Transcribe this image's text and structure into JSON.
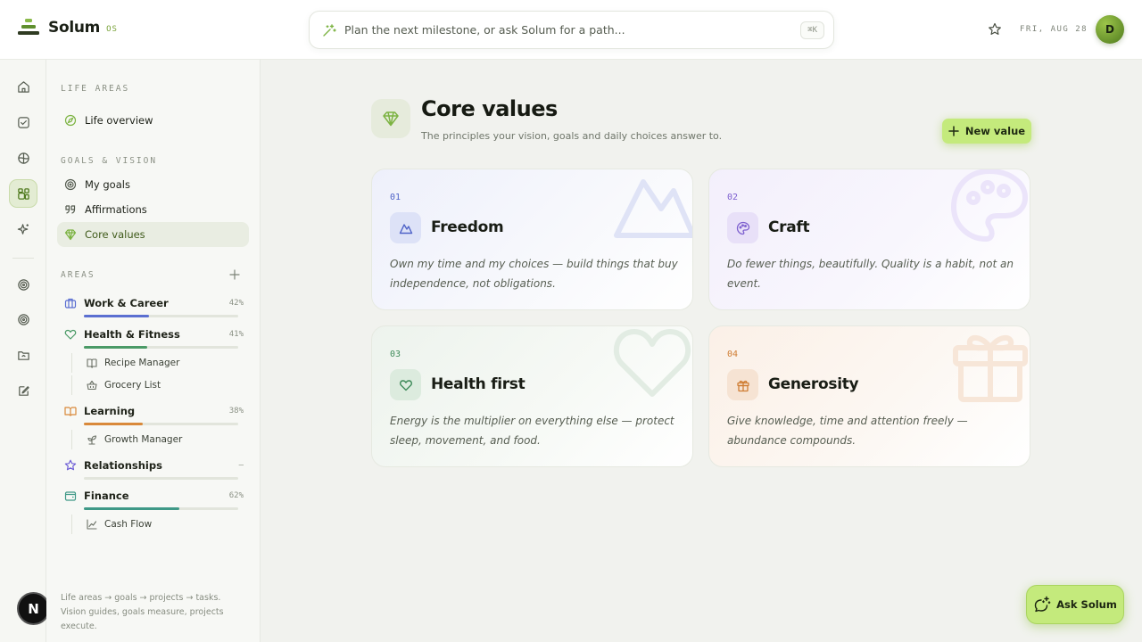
{
  "brand": {
    "name": "Solum",
    "tag": "OS"
  },
  "search": {
    "placeholder": "Plan the next milestone, or ask Solum for a path...",
    "shortcut": "⌘K"
  },
  "top": {
    "date": "FRI, AUG 28",
    "avatar_initial": "D"
  },
  "rail": {
    "items": [
      "home-icon",
      "check-square-icon",
      "compass-icon",
      "grid-icon",
      "sparkle-icon",
      "target-icon",
      "target-icon",
      "folder-icon",
      "edit-icon"
    ],
    "bottom_initial": "N"
  },
  "sidebar": {
    "life_areas_label": "LIFE AREAS",
    "life_overview": "Life overview",
    "goals_vision_label": "GOALS & VISION",
    "my_goals": "My goals",
    "affirmations": "Affirmations",
    "core_values": "Core values",
    "areas_label": "AREAS",
    "areas": [
      {
        "name": "Work & Career",
        "pct": "42%",
        "progress": 0.42,
        "color": "#5b6fd1"
      },
      {
        "name": "Health & Fitness",
        "pct": "41%",
        "progress": 0.41,
        "color": "#4a9a66"
      },
      {
        "name": "Learning",
        "pct": "38%",
        "progress": 0.38,
        "color": "#d9893a"
      },
      {
        "name": "Relationships",
        "pct": "–",
        "progress": 0,
        "color": "#8a7bd8"
      },
      {
        "name": "Finance",
        "pct": "62%",
        "progress": 0.62,
        "color": "#3f9987"
      }
    ],
    "sub": {
      "recipe_manager": "Recipe Manager",
      "grocery_list": "Grocery List",
      "growth_manager": "Growth Manager",
      "cash_flow": "Cash Flow"
    },
    "footer": "Life areas → goals → projects → tasks. Vision guides, goals measure, projects execute."
  },
  "main": {
    "title": "Core values",
    "subtitle": "The principles your vision, goals and daily choices answer to.",
    "new_button": "New value",
    "cards": [
      {
        "num": "01",
        "name": "Freedom",
        "desc": "Own my time and my choices — build things that buy independence, not obligations.",
        "icon": "mountain-icon",
        "accent": "#4f63c8"
      },
      {
        "num": "02",
        "name": "Craft",
        "desc": "Do fewer things, beautifully. Quality is a habit, not an event.",
        "icon": "palette-icon",
        "accent": "#7d5fcf"
      },
      {
        "num": "03",
        "name": "Health first",
        "desc": "Energy is the multiplier on everything else — protect sleep, movement, and food.",
        "icon": "heart-icon",
        "accent": "#3f8b5a"
      },
      {
        "num": "04",
        "name": "Generosity",
        "desc": "Give knowledge, time and attention freely — abundance compounds.",
        "icon": "gift-icon",
        "accent": "#cf7d33"
      }
    ]
  },
  "ask": {
    "label": "Ask Solum"
  }
}
